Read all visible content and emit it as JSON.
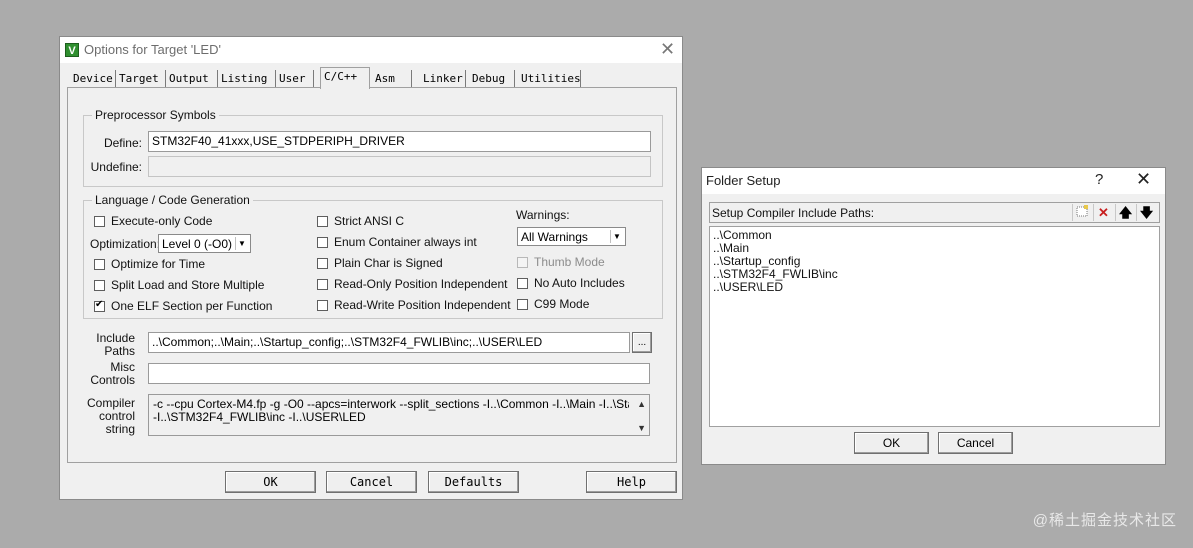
{
  "options_dialog": {
    "title": "Options for Target 'LED'",
    "tabs": [
      "Device",
      "Target",
      "Output",
      "Listing",
      "User",
      "C/C++",
      "Asm",
      "Linker",
      "Debug",
      "Utilities"
    ],
    "active_tab": "C/C++",
    "preprocessor": {
      "group_title": "Preprocessor Symbols",
      "define_label": "Define:",
      "define_value": "STM32F40_41xxx,USE_STDPERIPH_DRIVER",
      "undefine_label": "Undefine:",
      "undefine_value": ""
    },
    "language": {
      "group_title": "Language / Code Generation",
      "execute_only": {
        "label": "Execute-only Code",
        "checked": false
      },
      "optimization_label": "Optimization:",
      "optimization_value": "Level 0 (-O0)",
      "optimize_for_time": {
        "label": "Optimize for Time",
        "checked": false
      },
      "split_load_store": {
        "label": "Split Load and Store Multiple",
        "checked": false
      },
      "one_elf_section": {
        "label": "One ELF Section per Function",
        "checked": true
      },
      "strict_ansi": {
        "label": "Strict ANSI C",
        "checked": false
      },
      "enum_container": {
        "label": "Enum Container always int",
        "checked": false
      },
      "plain_char_signed": {
        "label": "Plain Char is Signed",
        "checked": false
      },
      "ro_position_independent": {
        "label": "Read-Only Position Independent",
        "checked": false
      },
      "rw_position_independent": {
        "label": "Read-Write Position Independent",
        "checked": false
      },
      "warnings_label": "Warnings:",
      "warnings_value": "All Warnings",
      "thumb_mode": {
        "label": "Thumb Mode",
        "checked": false,
        "disabled": true
      },
      "no_auto_includes": {
        "label": "No Auto Includes",
        "checked": false
      },
      "c99_mode": {
        "label": "C99 Mode",
        "checked": false
      }
    },
    "include_paths_label_1": "Include",
    "include_paths_label_2": "Paths",
    "include_paths_value": "..\\Common;..\\Main;..\\Startup_config;..\\STM32F4_FWLIB\\inc;..\\USER\\LED",
    "browse_label": "...",
    "misc_controls_label_1": "Misc",
    "misc_controls_label_2": "Controls",
    "misc_controls_value": "",
    "compiler_string_label_1": "Compiler",
    "compiler_string_label_2": "control",
    "compiler_string_label_3": "string",
    "compiler_string_line_1": "-c --cpu Cortex-M4.fp -g -O0 --apcs=interwork --split_sections -I..\\Common -I..\\Main -I..\\Startup_config",
    "compiler_string_line_2": "-I..\\STM32F4_FWLIB\\inc -I..\\USER\\LED",
    "buttons": {
      "ok": "OK",
      "cancel": "Cancel",
      "defaults": "Defaults",
      "help": "Help"
    }
  },
  "folder_setup": {
    "title": "Folder Setup",
    "help": "?",
    "header_label": "Setup Compiler Include Paths:",
    "paths": [
      "..\\Common",
      "..\\Main",
      "..\\Startup_config",
      "..\\STM32F4_FWLIB\\inc",
      "..\\USER\\LED"
    ],
    "buttons": {
      "ok": "OK",
      "cancel": "Cancel"
    }
  },
  "watermark": "@稀土掘金技术社区",
  "icons": {
    "app": "keil-uvision-icon",
    "new_folder": "new-folder-icon",
    "delete": "delete-icon",
    "move_up": "arrow-up-icon",
    "move_down": "arrow-down-icon"
  },
  "colors": {
    "background": "#ababab",
    "dialog": "#f0f0f0",
    "delete_red": "#c81e1e"
  }
}
